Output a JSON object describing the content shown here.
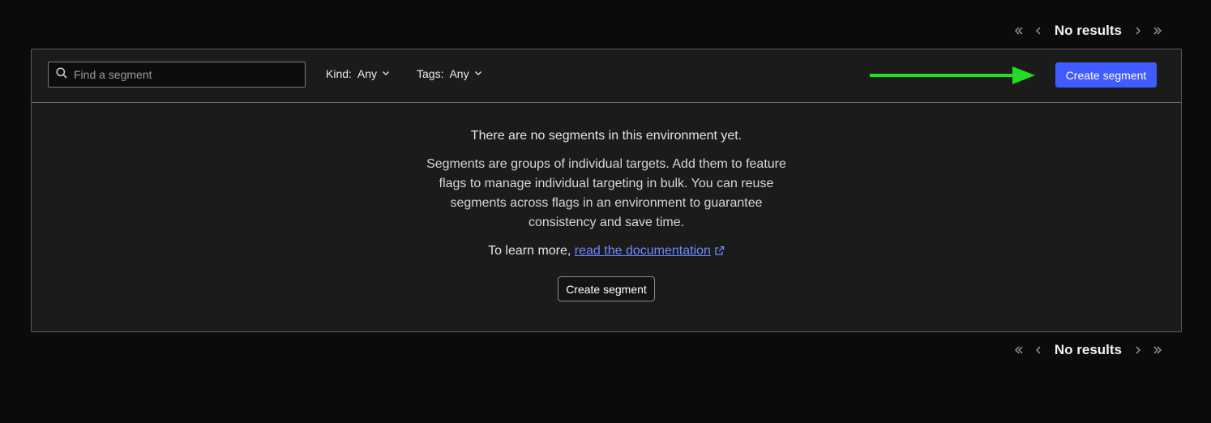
{
  "pagination": {
    "label": "No results"
  },
  "search": {
    "placeholder": "Find a segment",
    "value": ""
  },
  "filters": {
    "kind_label": "Kind:",
    "kind_value": "Any",
    "tags_label": "Tags:",
    "tags_value": "Any"
  },
  "toolbar": {
    "create_label": "Create segment"
  },
  "empty_state": {
    "headline": "There are no segments in this environment yet.",
    "description": "Segments are groups of individual targets. Add them to feature flags to manage individual targeting in bulk. You can reuse segments across flags in an environment to guarantee consistency and save time.",
    "learn_prefix": "To learn more, ",
    "link_text": "read the documentation",
    "create_label": "Create segment"
  },
  "colors": {
    "background": "#0b0b0c",
    "panel": "#1b1b1c",
    "primary": "#405bff",
    "link": "#6f8bff",
    "arrow": "#22dd22"
  },
  "icons": [
    "double-chevron-left-icon",
    "chevron-left-icon",
    "chevron-right-icon",
    "double-chevron-right-icon",
    "search-icon",
    "chevron-down-icon",
    "external-link-icon"
  ]
}
